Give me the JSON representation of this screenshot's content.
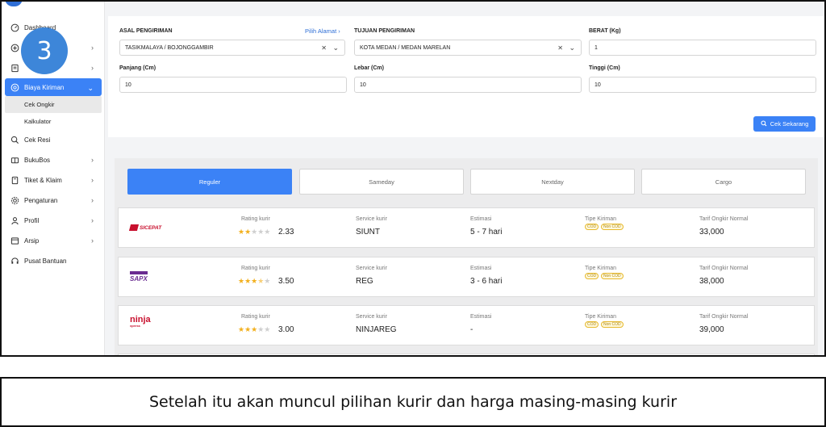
{
  "sidebar": {
    "items": [
      {
        "label": "Dashboard",
        "icon": "dashboard-icon"
      },
      {
        "label": "",
        "icon": "plus-circle-icon"
      },
      {
        "label": "",
        "icon": "document-icon"
      },
      {
        "label": "Biaya Kiriman",
        "icon": "shipping-cost-icon"
      },
      {
        "label": "Cek Resi",
        "icon": "search-receipt-icon"
      },
      {
        "label": "BukuBos",
        "icon": "book-icon"
      },
      {
        "label": "Tiket & Klaim",
        "icon": "ticket-icon"
      },
      {
        "label": "Pengaturan",
        "icon": "gear-icon"
      },
      {
        "label": "Profil",
        "icon": "user-icon"
      },
      {
        "label": "Arsip",
        "icon": "archive-icon"
      },
      {
        "label": "Pusat Bantuan",
        "icon": "headset-icon"
      }
    ],
    "sub_items": [
      {
        "label": "Cek Ongkir"
      },
      {
        "label": "Kalkulator"
      }
    ],
    "step_badge": "3"
  },
  "form": {
    "origin_label": "ASAL PENGIRIMAN",
    "origin_link": "Pilih Alamat",
    "origin_value": "TASIKMALAYA / BOJONGGAMBIR",
    "dest_label": "TUJUAN PENGIRIMAN",
    "dest_value": "KOTA MEDAN / MEDAN MARELAN",
    "weight_label": "BERAT (Kg)",
    "weight_value": "1",
    "length_label": "Panjang (Cm)",
    "length_value": "10",
    "width_label": "Lebar (Cm)",
    "width_value": "10",
    "height_label": "Tinggi (Cm)",
    "height_value": "10",
    "submit_label": "Cek Sekarang"
  },
  "tabs": [
    {
      "label": "Reguler",
      "active": true
    },
    {
      "label": "Sameday",
      "active": false
    },
    {
      "label": "Nextday",
      "active": false
    },
    {
      "label": "Cargo",
      "active": false
    }
  ],
  "columns": {
    "rating": "Rating kurir",
    "service": "Service kurir",
    "estimate": "Estimasi",
    "type": "Tipe Kiriman",
    "tariff": "Tarif Ongkir Normal"
  },
  "couriers": [
    {
      "logo_text": "SICEPAT",
      "rating": "2.33",
      "rating_stars": 2.33,
      "service": "SIUNT",
      "estimate": "5 - 7 hari",
      "tags": [
        "COD",
        "Non COD"
      ],
      "tariff": "33,000",
      "brand_color": "#c8102e"
    },
    {
      "logo_text": "SAPX",
      "rating": "3.50",
      "rating_stars": 3.5,
      "service": "REG",
      "estimate": "3 - 6 hari",
      "tags": [
        "COD",
        "Non COD"
      ],
      "tariff": "38,000",
      "brand_color": "#6a2c91"
    },
    {
      "logo_text": "ninja",
      "logo_sub": "xpress",
      "rating": "3.00",
      "rating_stars": 3,
      "service": "NINJAREG",
      "estimate": "-",
      "tags": [
        "COD",
        "Non COD"
      ],
      "tariff": "39,000",
      "brand_color": "#c8102e"
    }
  ],
  "caption": "Setelah itu akan muncul pilihan kurir dan harga masing-masing kurir",
  "colors": {
    "accent": "#3b82f6",
    "badge": "#3d86d9"
  }
}
